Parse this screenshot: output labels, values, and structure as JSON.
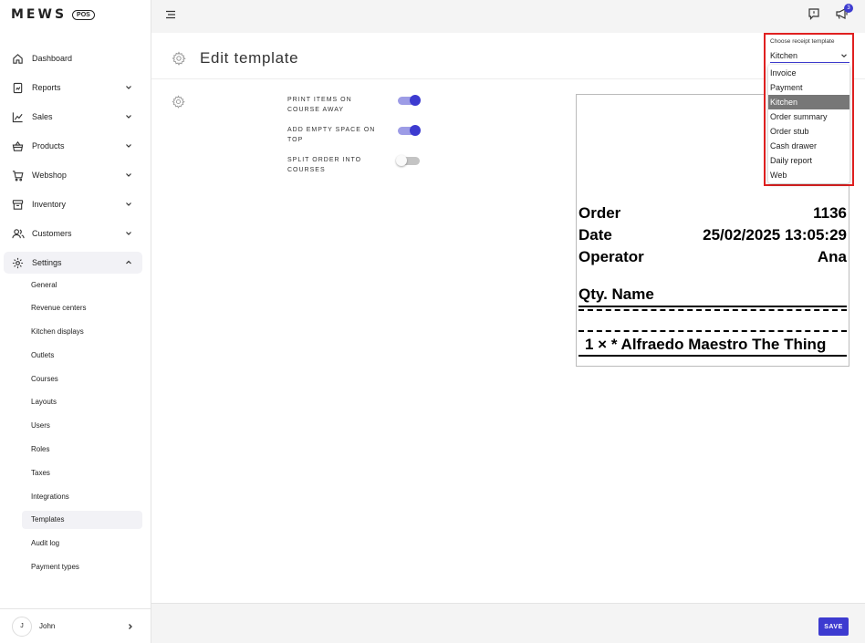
{
  "brand": {
    "name": "MEWS",
    "badge": "POS"
  },
  "sidebar": {
    "items": [
      {
        "label": "Dashboard",
        "icon": "home-icon"
      },
      {
        "label": "Reports",
        "icon": "document-icon"
      },
      {
        "label": "Sales",
        "icon": "chart-line-icon"
      },
      {
        "label": "Products",
        "icon": "basket-icon"
      },
      {
        "label": "Webshop",
        "icon": "cart-icon"
      },
      {
        "label": "Inventory",
        "icon": "box-icon"
      },
      {
        "label": "Customers",
        "icon": "users-icon"
      },
      {
        "label": "Settings",
        "icon": "gear-icon"
      }
    ],
    "settings_children": [
      "General",
      "Revenue centers",
      "Kitchen displays",
      "Outlets",
      "Courses",
      "Layouts",
      "Users",
      "Roles",
      "Taxes",
      "Integrations",
      "Templates",
      "Audit log",
      "Payment types"
    ],
    "active_child": "Templates",
    "user": {
      "initial": "J",
      "name": "John"
    }
  },
  "topbar": {
    "notification_count": "3"
  },
  "page": {
    "title": "Edit template"
  },
  "options": [
    {
      "label": "PRINT ITEMS ON COURSE AWAY",
      "enabled": true
    },
    {
      "label": "ADD EMPTY SPACE ON TOP",
      "enabled": true
    },
    {
      "label": "SPLIT ORDER INTO COURSES",
      "enabled": false
    }
  ],
  "receipt": {
    "order_label": "Order",
    "order_value": "1136",
    "date_label": "Date",
    "date_value": "25/02/2025 13:05:29",
    "operator_label": "Operator",
    "operator_value": "Ana",
    "columns_header": "Qty. Name",
    "item_line": "1 × * Alfraedo Maestro The Thing"
  },
  "template_chooser": {
    "label": "Choose receipt template",
    "selected": "Kitchen",
    "options": [
      "Invoice",
      "Payment",
      "Kitchen",
      "Order summary",
      "Order stub",
      "Cash drawer",
      "Daily report",
      "Web"
    ]
  },
  "footer": {
    "save_label": "SAVE"
  },
  "colors": {
    "accent": "#3d3bd0",
    "highlight_border": "#e02020"
  }
}
